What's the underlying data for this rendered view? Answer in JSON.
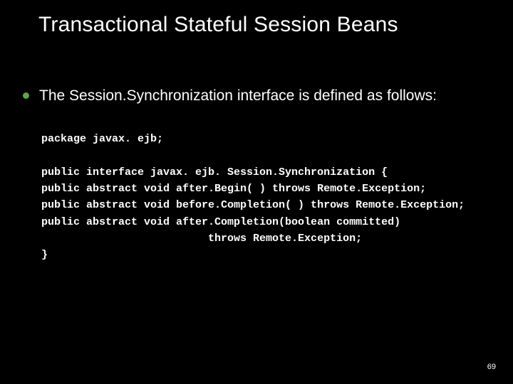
{
  "title": "Transactional Stateful Session Beans",
  "bullet_text": "The Session.Synchronization interface is defined as follows:",
  "code": {
    "l1": "package javax. ejb;",
    "l2": "",
    "l3": "public interface javax. ejb. Session.Synchronization {",
    "l4": "public abstract void after.Begin( ) throws Remote.Exception;",
    "l5": "public abstract void before.Completion( ) throws Remote.Exception;",
    "l6": "public abstract void after.Completion(boolean committed)",
    "l7": "                          throws Remote.Exception;",
    "l8": "}"
  },
  "page_number": "69"
}
